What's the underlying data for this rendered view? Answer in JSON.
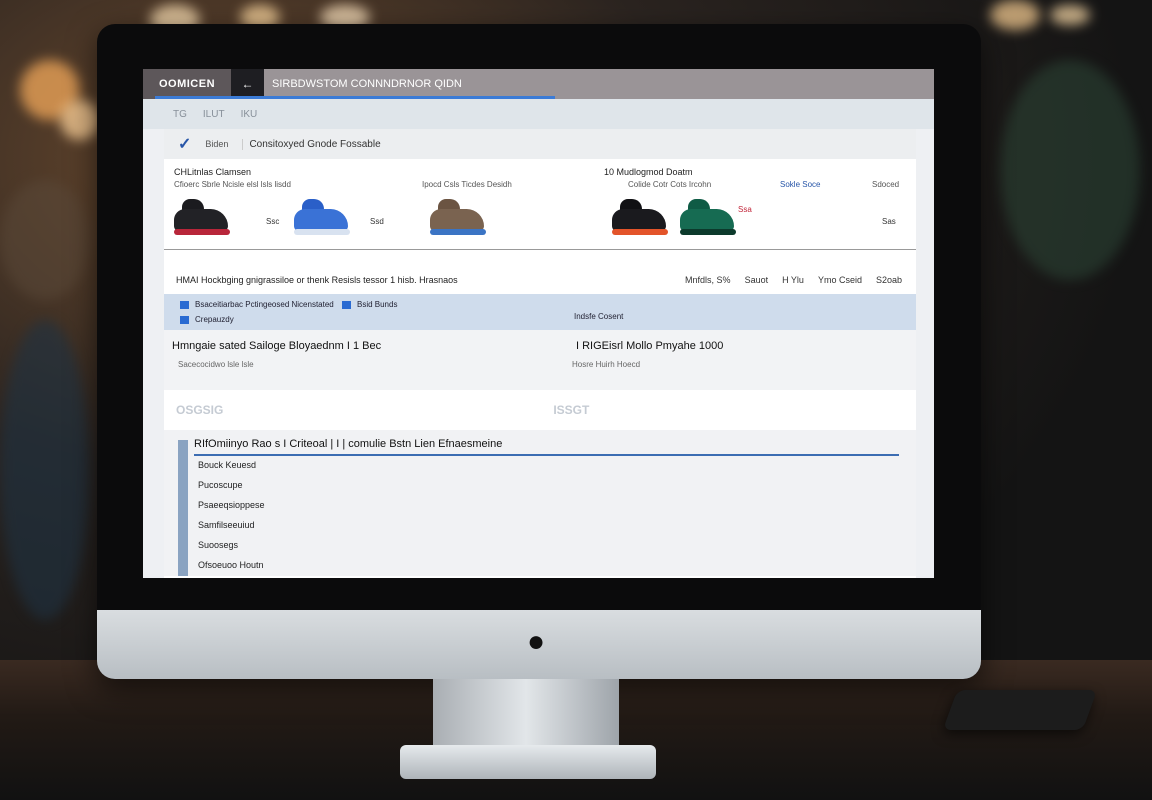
{
  "browser": {
    "brand": "OOMICEN",
    "back_icon": "arrow-left-icon",
    "url": "SIRBDWSTOM CONNNDRNOR QIDN",
    "nav_items": [
      "TG",
      "ILUT",
      "IKU"
    ]
  },
  "store": {
    "logo_icon": "brand-check-icon",
    "label": "Biden",
    "title": "Consitoxyed Gnode Fossable"
  },
  "products": {
    "left_title": "CHLitnlas Clamsen",
    "left_subtitle": "Cfioerc Sbrle Ncisle elsl lsls lisdd",
    "mid_subtitle": "Ipocd Csls Ticdes Desidh",
    "right_title": "10 Mudlogmod Doatm",
    "right_subtitle": "Colide Cotr Cots Ircohn",
    "right_tag": "Sokle Soce",
    "right_price": "Sdoced",
    "prices": [
      "Ssc",
      "Ssd",
      "Ssa",
      "Sas"
    ]
  },
  "info_row": {
    "left": "HMAI Hockbging gnigrassiloe or thenk Resisls tessor 1 hisb. Hrasnaos",
    "right_items": [
      "Mnfdls, S%",
      "Sauot",
      "H Ylu",
      "Ymo Cseid",
      "S2oab"
    ]
  },
  "filter_row": {
    "line1": "Bsaceitiarbac Pctingeosed Nicenstated",
    "tag": "Bsid Bunds",
    "line2": "Crepauzdy",
    "middle": "Indsfe Cosent"
  },
  "search_row": {
    "title": "Hmngaie sated Sailoge Bloyaednm I 1 Bec",
    "right": "I RIGEisrl Mollo Pmyahe 1000",
    "sub_left": "Sacecocidwo  lsle  lsle",
    "sub_right": "Hosre  Huirh  Hoecd"
  },
  "section": {
    "left": "OSGSIG",
    "right": "ISSGT"
  },
  "panel": {
    "title": "RIfOmiinyo Rao s I Criteoal | I | comulie Bstn Lien Efnaesmeine",
    "items": [
      "Bouck Keuesd",
      "Pucoscupe",
      "Psaeeqsioppese",
      "Samfilseeuiud",
      "Suoosegs",
      "Ofsoeuoo Houtn"
    ]
  },
  "monitor": {
    "logo_icon": "apple-logo-icon"
  }
}
